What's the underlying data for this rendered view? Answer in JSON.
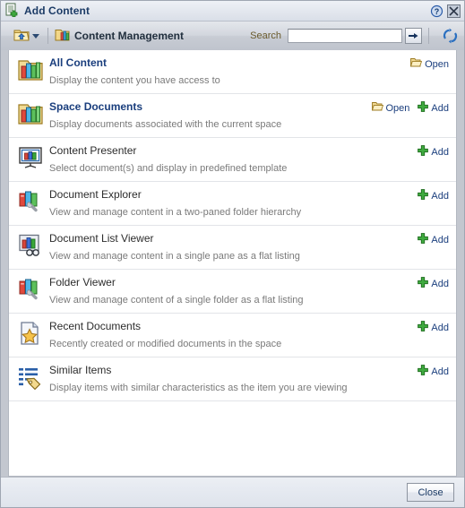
{
  "window": {
    "title": "Add Content",
    "title_icon": "add-content-icon",
    "help_icon": "help-icon",
    "close_icon": "close-icon"
  },
  "toolbar": {
    "up_icon": "folder-up-icon",
    "dropdown_icon": "chevron-down-icon",
    "breadcrumb_icon": "content-management-icon",
    "breadcrumb_label": "Content Management",
    "search_label": "Search",
    "search_value": "",
    "search_placeholder": "",
    "search_go_icon": "arrow-right-icon",
    "refresh_icon": "refresh-icon"
  },
  "list": {
    "open_label": "Open",
    "add_label": "Add",
    "open_icon": "open-folder-icon",
    "add_icon": "plus-icon",
    "items": [
      {
        "icon": "all-content-icon",
        "title": "All Content",
        "description": "Display the content you have access to",
        "linked": true,
        "actions": [
          "Open"
        ]
      },
      {
        "icon": "space-documents-icon",
        "title": "Space Documents",
        "description": "Display documents associated with the current space",
        "linked": true,
        "actions": [
          "Open",
          "Add"
        ]
      },
      {
        "icon": "content-presenter-icon",
        "title": "Content Presenter",
        "description": "Select document(s) and display in predefined template",
        "linked": false,
        "actions": [
          "Add"
        ]
      },
      {
        "icon": "document-explorer-icon",
        "title": "Document Explorer",
        "description": "View and manage content in a two-paned folder hierarchy",
        "linked": false,
        "actions": [
          "Add"
        ]
      },
      {
        "icon": "document-list-viewer-icon",
        "title": "Document List Viewer",
        "description": "View and manage content in a single pane as a flat listing",
        "linked": false,
        "actions": [
          "Add"
        ]
      },
      {
        "icon": "folder-viewer-icon",
        "title": "Folder Viewer",
        "description": "View and manage content of a single folder as a flat listing",
        "linked": false,
        "actions": [
          "Add"
        ]
      },
      {
        "icon": "recent-documents-icon",
        "title": "Recent Documents",
        "description": "Recently created or modified documents in the space",
        "linked": false,
        "actions": [
          "Add"
        ]
      },
      {
        "icon": "similar-items-icon",
        "title": "Similar Items",
        "description": "Display items with similar characteristics as the item you are viewing",
        "linked": false,
        "actions": [
          "Add"
        ]
      }
    ]
  },
  "footer": {
    "close_label": "Close"
  },
  "colors": {
    "link": "#1a3e7d",
    "title": "#1c3b66",
    "description": "#7a7a7a",
    "search_label": "#6a5a2c",
    "dialog_bg": "#c3c7cf"
  }
}
